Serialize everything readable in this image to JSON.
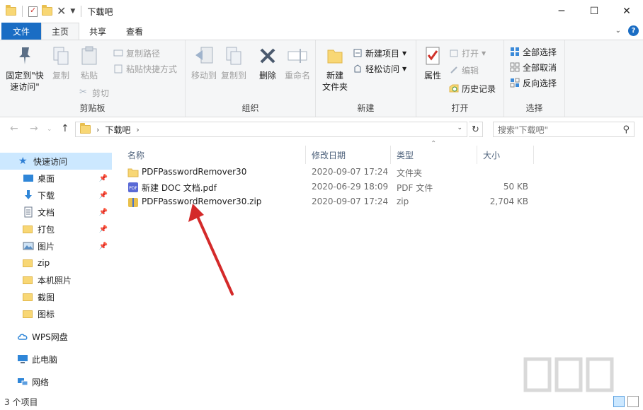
{
  "window": {
    "title": "下载吧",
    "controls": {
      "minimize": "─",
      "maximize": "☐",
      "close": "✕"
    }
  },
  "ribbon_tabs": [
    {
      "label": "文件"
    },
    {
      "label": "主页"
    },
    {
      "label": "共享"
    },
    {
      "label": "查看"
    }
  ],
  "ribbon": {
    "clipboard": {
      "label": "剪贴板",
      "pin_quick_line1": "固定到\"快",
      "pin_quick_line2": "速访问\"",
      "copy": "复制",
      "paste": "粘贴",
      "copy_path": "复制路径",
      "paste_shortcut": "粘贴快捷方式",
      "cut": "剪切"
    },
    "organize": {
      "label": "组织",
      "move_to": "移动到",
      "copy_to": "复制到",
      "delete": "删除",
      "rename": "重命名"
    },
    "new": {
      "label": "新建",
      "new_folder_line1": "新建",
      "new_folder_line2": "文件夹",
      "new_item": "新建项目",
      "easy_access": "轻松访问"
    },
    "open": {
      "label": "打开",
      "properties": "属性",
      "open": "打开",
      "edit": "编辑",
      "history": "历史记录"
    },
    "select": {
      "label": "选择",
      "select_all": "全部选择",
      "select_none": "全部取消",
      "invert": "反向选择"
    }
  },
  "address": {
    "crumb": "下载吧",
    "search_placeholder": "搜索\"下载吧\""
  },
  "nav": {
    "quick_access": "快速访问",
    "items": [
      {
        "label": "桌面",
        "icon": "desktop-icon",
        "pinned": true
      },
      {
        "label": "下载",
        "icon": "download-icon",
        "pinned": true
      },
      {
        "label": "文档",
        "icon": "document-icon",
        "pinned": true
      },
      {
        "label": "打包",
        "icon": "folder-icon",
        "pinned": true
      },
      {
        "label": "图片",
        "icon": "pictures-icon",
        "pinned": true
      },
      {
        "label": "zip",
        "icon": "folder-icon",
        "pinned": false
      },
      {
        "label": "本机照片",
        "icon": "folder-icon",
        "pinned": false
      },
      {
        "label": "截图",
        "icon": "folder-icon",
        "pinned": false
      },
      {
        "label": "图标",
        "icon": "folder-icon",
        "pinned": false
      }
    ],
    "wps": "WPS网盘",
    "this_pc": "此电脑",
    "network": "网络"
  },
  "columns": {
    "name": "名称",
    "date": "修改日期",
    "type": "类型",
    "size": "大小"
  },
  "files": [
    {
      "name": "PDFPasswordRemover30",
      "date": "2020-09-07 17:24",
      "type": "文件夹",
      "size": "",
      "icon": "folder-icon"
    },
    {
      "name": "新建 DOC 文档.pdf",
      "date": "2020-06-29 18:09",
      "type": "PDF 文件",
      "size": "50 KB",
      "icon": "pdf-icon"
    },
    {
      "name": "PDFPasswordRemover30.zip",
      "date": "2020-09-07 17:24",
      "type": "zip",
      "size": "2,704 KB",
      "icon": "zip-icon"
    }
  ],
  "status": {
    "count": "3 个项目"
  },
  "colors": {
    "accent": "#1a6dc4",
    "selection": "#cce8ff",
    "arrow": "#d42a2a"
  }
}
